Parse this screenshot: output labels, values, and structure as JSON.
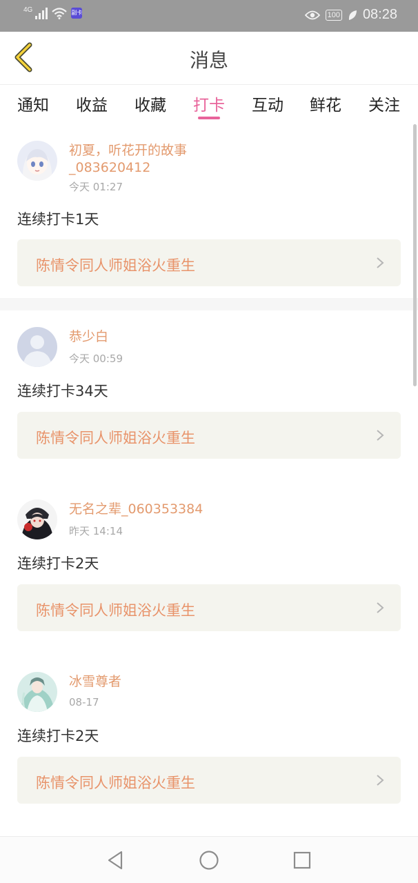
{
  "status_bar": {
    "network": "4G",
    "sim_badge": "副卡",
    "battery": "100",
    "time": "08:28"
  },
  "header": {
    "title": "消息"
  },
  "tabs": [
    {
      "label": "通知",
      "active": false
    },
    {
      "label": "收益",
      "active": false
    },
    {
      "label": "收藏",
      "active": false
    },
    {
      "label": "打卡",
      "active": true
    },
    {
      "label": "互动",
      "active": false
    },
    {
      "label": "鲜花",
      "active": false
    },
    {
      "label": "关注",
      "active": false
    }
  ],
  "colors": {
    "accent": "#e8639a",
    "username": "#e39a6e",
    "link_text": "#e8936a",
    "link_bg": "#f4f4ee"
  },
  "checkins": [
    {
      "avatar": "chibi-girl-avatar",
      "name_line1": "初夏，听花开的故事",
      "name_line2": "_083620412",
      "time": "今天 01:27",
      "text": "连续打卡1天",
      "book": "陈情令同人师姐浴火重生"
    },
    {
      "avatar": "default-avatar",
      "name_line1": "恭少白",
      "name_line2": "",
      "time": "今天 00:59",
      "text": "连续打卡34天",
      "book": "陈情令同人师姐浴火重生"
    },
    {
      "avatar": "dark-character-avatar",
      "name_line1": "无名之辈_060353384",
      "name_line2": "",
      "time": "昨天 14:14",
      "text": "连续打卡2天",
      "book": "陈情令同人师姐浴火重生"
    },
    {
      "avatar": "ancient-costume-avatar",
      "name_line1": "冰雪尊者",
      "name_line2": "",
      "time": "08-17",
      "text": "连续打卡2天",
      "book": "陈情令同人师姐浴火重生"
    }
  ]
}
